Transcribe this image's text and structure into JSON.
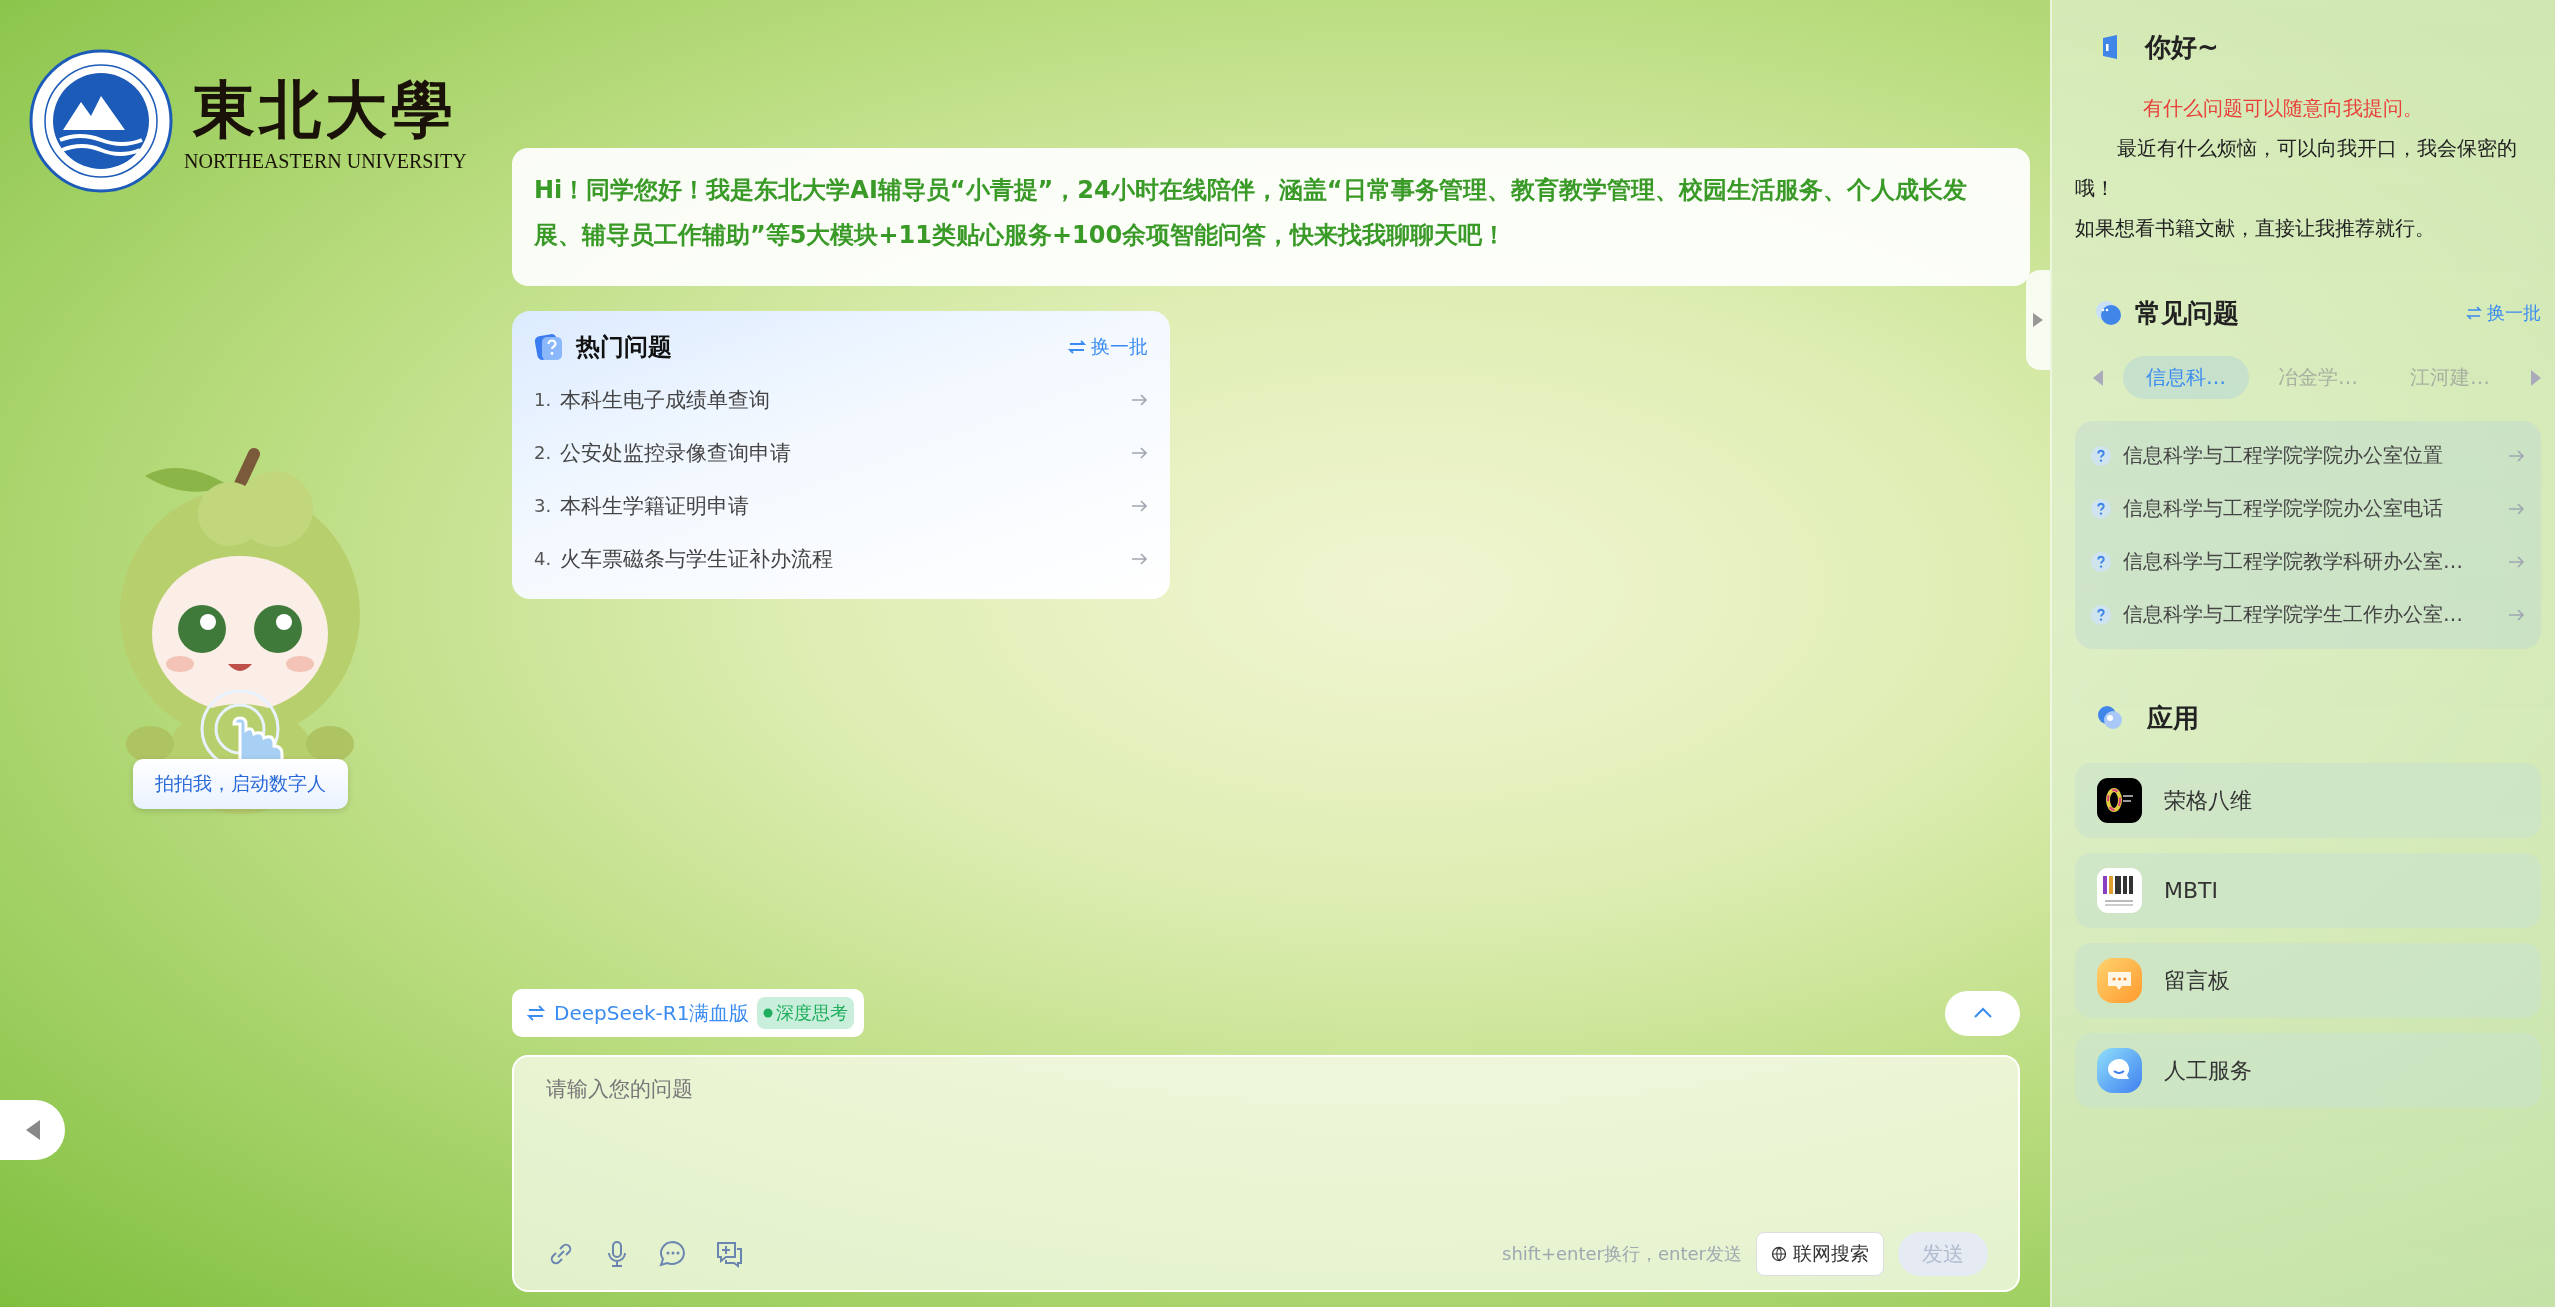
{
  "logo": {
    "name_zh": "東北大學",
    "name_en": "NORTHEASTERN UNIVERSITY"
  },
  "mascot": {
    "button": "拍拍我，启动数字人"
  },
  "welcome": "Hi！同学您好！我是东北大学AI辅导员“小青提”，24小时在线陪伴，涵盖“日常事务管理、教育教学管理、校园生活服务、个人成长发展、辅导员工作辅助”等5大模块+11类贴心服务+100余项智能问答，快来找我聊聊天吧！",
  "hot_questions": {
    "title": "热门问题",
    "refresh": "换一批",
    "items": [
      {
        "number": "1.",
        "text": "本科生电子成绩单查询"
      },
      {
        "number": "2.",
        "text": "公安处监控录像查询申请"
      },
      {
        "number": "3.",
        "text": "本科生学籍证明申请"
      },
      {
        "number": "4.",
        "text": "火车票磁条与学生证补办流程"
      }
    ]
  },
  "model_selector": {
    "name": "DeepSeek-R1满血版",
    "badge": "深度思考"
  },
  "input": {
    "placeholder": "请输入您的问题",
    "hint": "shift+enter换行，enter发送",
    "web_search": "联网搜索",
    "send": {
      "label": "发送",
      "disabled": true
    }
  },
  "greeting": {
    "title": "你好~",
    "highlight": "有什么问题可以随意向我提问。",
    "paragraphs": [
      "最近有什么烦恼，可以向我开口，我会保密的哦！",
      "如果想看书籍文献，直接让我推荐就行。"
    ]
  },
  "faq": {
    "title": "常见问题",
    "refresh": "换一批",
    "tabs": [
      {
        "label": "信息科…",
        "selected": true
      },
      {
        "label": "冶金学…",
        "selected": false
      },
      {
        "label": "江河建…",
        "selected": false
      }
    ],
    "items": [
      "信息科学与工程学院学院办公室位置",
      "信息科学与工程学院学院办公室电话",
      "信息科学与工程学院教学科研办公室…",
      "信息科学与工程学院学生工作办公室…"
    ]
  },
  "apps": {
    "title": "应用",
    "items": [
      {
        "label": "荣格八维",
        "kind": "jung"
      },
      {
        "label": "MBTI",
        "kind": "mbti"
      },
      {
        "label": "留言板",
        "kind": "board"
      },
      {
        "label": "人工服务",
        "kind": "service"
      }
    ]
  }
}
